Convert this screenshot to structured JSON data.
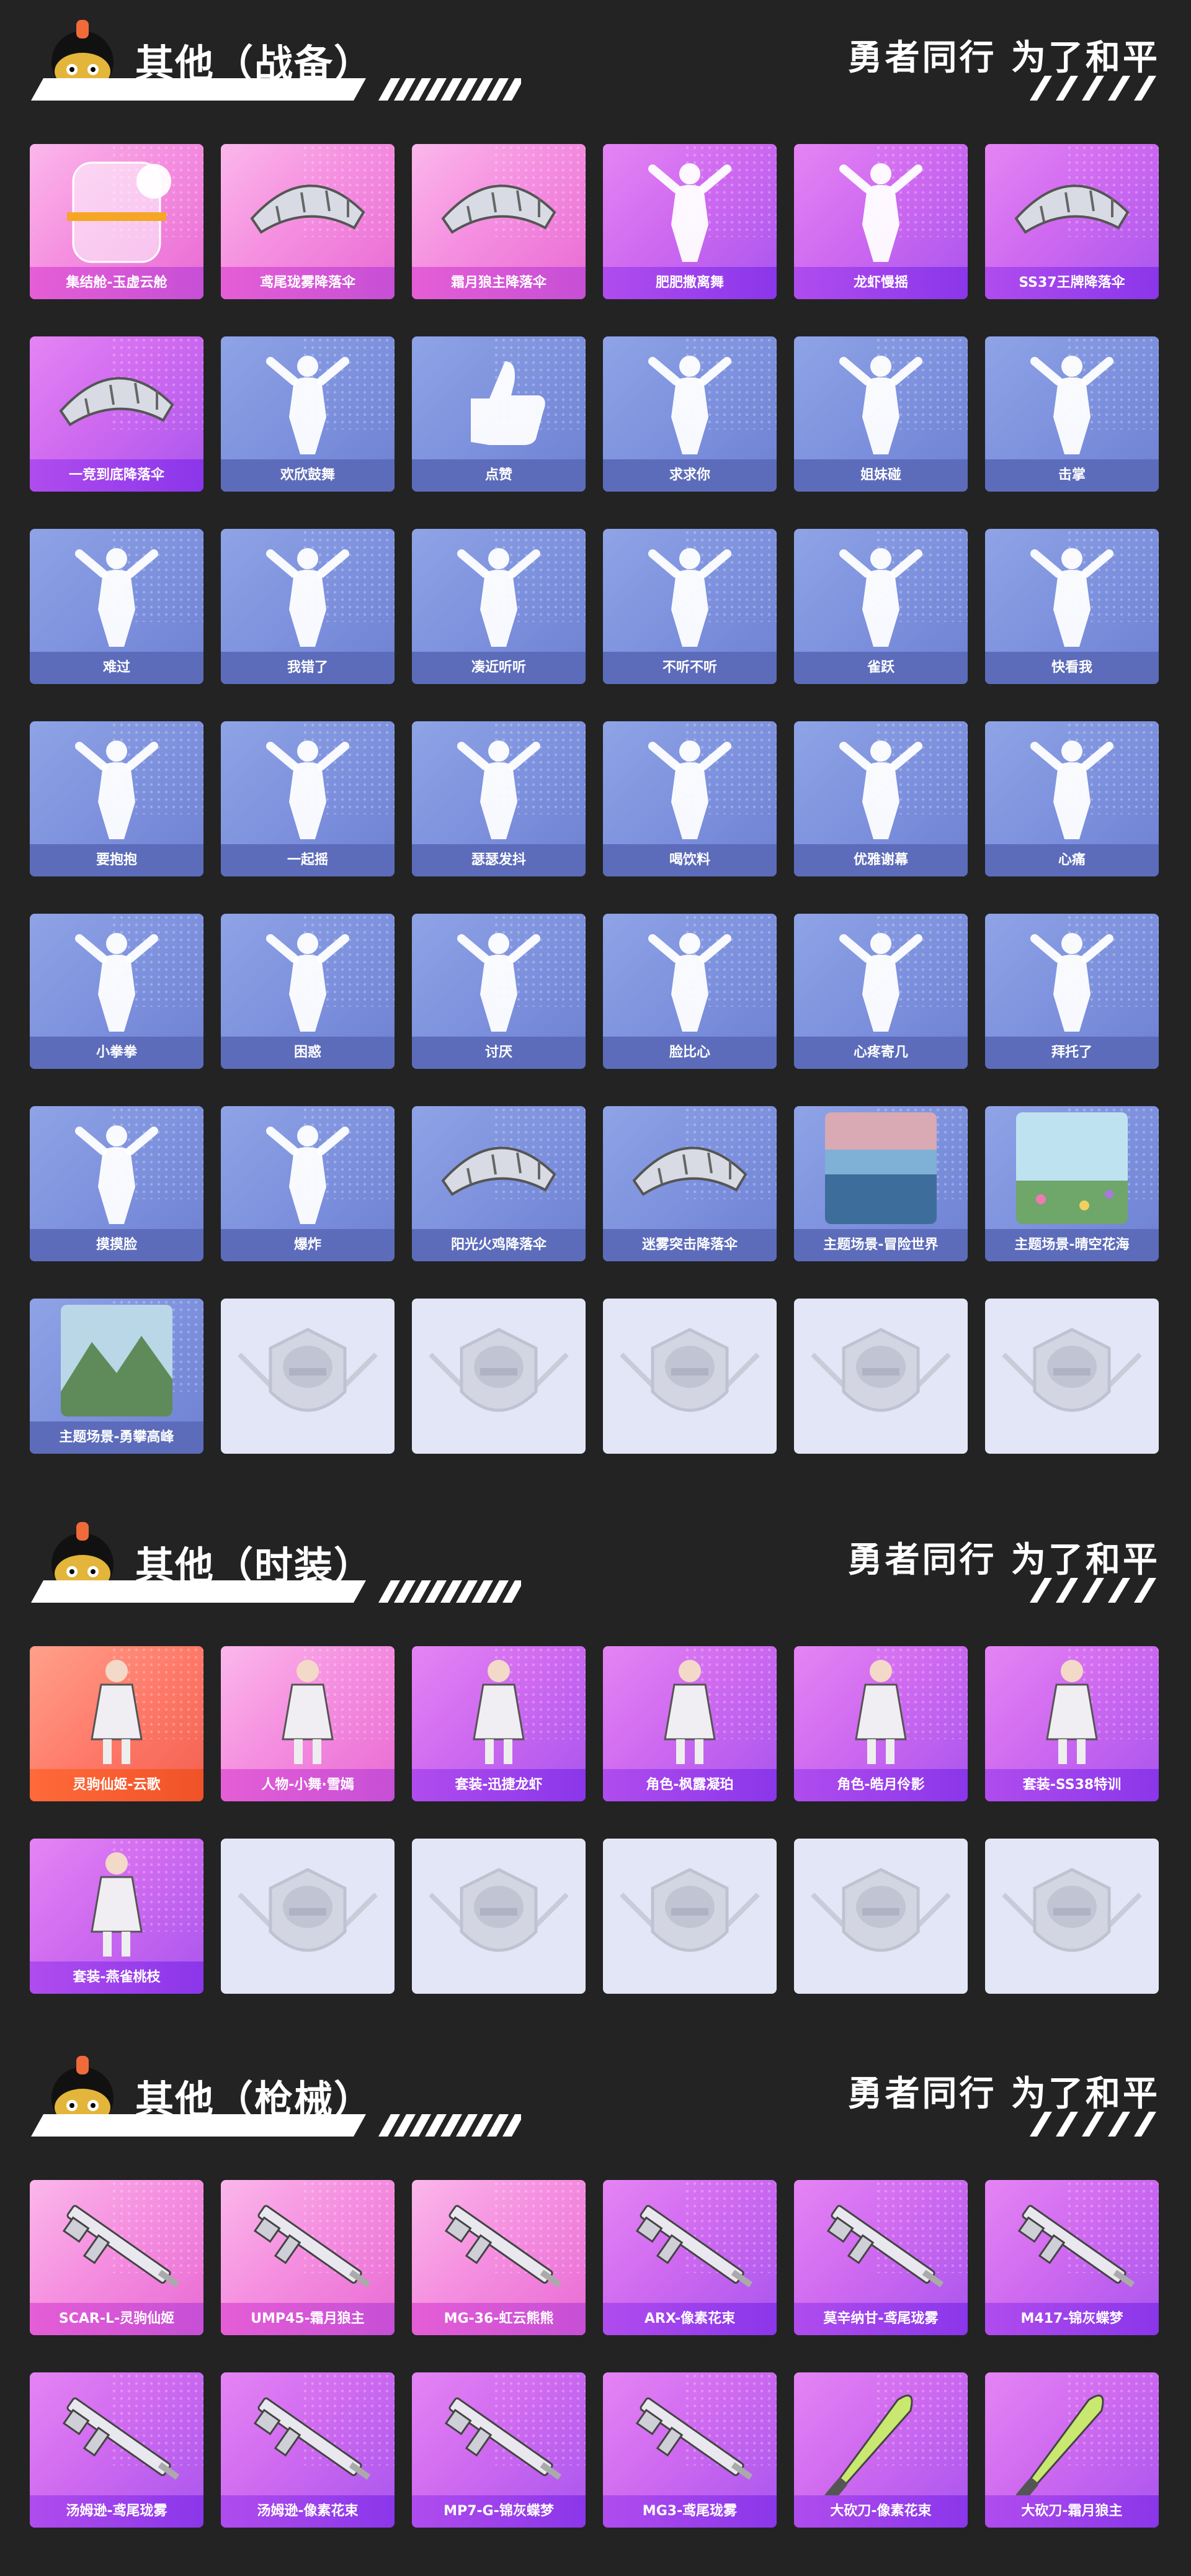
{
  "slogan": "勇者同行 为了和平",
  "sections": [
    {
      "title": "其他（战备）",
      "items": [
        {
          "label": "集结舱-玉虚云舱",
          "theme": "pink",
          "icon": "capsule-icon"
        },
        {
          "label": "鸢尾珑雾降落伞",
          "theme": "pink",
          "icon": "parachute-icon"
        },
        {
          "label": "霜月狼主降落伞",
          "theme": "pink",
          "icon": "parachute-icon"
        },
        {
          "label": "肥肥撒离舞",
          "theme": "purple",
          "icon": "emote-figure-icon"
        },
        {
          "label": "龙虾慢摇",
          "theme": "purple",
          "icon": "emote-figure-icon"
        },
        {
          "label": "SS37王牌降落伞",
          "theme": "purple",
          "icon": "parachute-icon"
        },
        {
          "label": "一竞到底降落伞",
          "theme": "purple",
          "icon": "parachute-icon"
        },
        {
          "label": "欢欣鼓舞",
          "theme": "blue",
          "icon": "emote-figure-icon"
        },
        {
          "label": "点赞",
          "theme": "blue",
          "icon": "thumbs-up-icon"
        },
        {
          "label": "求求你",
          "theme": "blue",
          "icon": "emote-figure-icon"
        },
        {
          "label": "姐妹碰",
          "theme": "blue",
          "icon": "emote-figure-icon"
        },
        {
          "label": "击掌",
          "theme": "blue",
          "icon": "emote-figure-icon"
        },
        {
          "label": "难过",
          "theme": "blue",
          "icon": "emote-figure-icon"
        },
        {
          "label": "我错了",
          "theme": "blue",
          "icon": "emote-figure-icon"
        },
        {
          "label": "凑近听听",
          "theme": "blue",
          "icon": "emote-figure-icon"
        },
        {
          "label": "不听不听",
          "theme": "blue",
          "icon": "emote-figure-icon"
        },
        {
          "label": "雀跃",
          "theme": "blue",
          "icon": "emote-figure-icon"
        },
        {
          "label": "快看我",
          "theme": "blue",
          "icon": "emote-figure-icon"
        },
        {
          "label": "要抱抱",
          "theme": "blue",
          "icon": "emote-figure-icon"
        },
        {
          "label": "一起摇",
          "theme": "blue",
          "icon": "emote-figure-icon"
        },
        {
          "label": "瑟瑟发抖",
          "theme": "blue",
          "icon": "emote-figure-icon"
        },
        {
          "label": "喝饮料",
          "theme": "blue",
          "icon": "emote-figure-icon"
        },
        {
          "label": "优雅谢幕",
          "theme": "blue",
          "icon": "emote-figure-icon"
        },
        {
          "label": "心痛",
          "theme": "blue",
          "icon": "emote-figure-icon"
        },
        {
          "label": "小拳拳",
          "theme": "blue",
          "icon": "emote-figure-icon"
        },
        {
          "label": "困惑",
          "theme": "blue",
          "icon": "emote-figure-icon"
        },
        {
          "label": "讨厌",
          "theme": "blue",
          "icon": "emote-figure-icon"
        },
        {
          "label": "脸比心",
          "theme": "blue",
          "icon": "emote-figure-icon"
        },
        {
          "label": "心疼寄几",
          "theme": "blue",
          "icon": "emote-figure-icon"
        },
        {
          "label": "拜托了",
          "theme": "blue",
          "icon": "emote-figure-icon"
        },
        {
          "label": "摸摸脸",
          "theme": "blue",
          "icon": "emote-figure-icon"
        },
        {
          "label": "爆炸",
          "theme": "blue",
          "icon": "emote-figure-icon"
        },
        {
          "label": "阳光火鸡降落伞",
          "theme": "blue",
          "icon": "parachute-icon"
        },
        {
          "label": "迷雾突击降落伞",
          "theme": "blue",
          "icon": "parachute-icon"
        },
        {
          "label": "主题场景-冒险世界",
          "theme": "blue",
          "icon": "scene-sea-icon"
        },
        {
          "label": "主题场景-晴空花海",
          "theme": "blue",
          "icon": "scene-flowers-icon"
        },
        {
          "label": "主题场景-勇攀高峰",
          "theme": "blue",
          "icon": "scene-mountain-icon"
        },
        {
          "label": "",
          "theme": "empty",
          "icon": "placeholder-emblem-icon"
        },
        {
          "label": "",
          "theme": "empty",
          "icon": "placeholder-emblem-icon"
        },
        {
          "label": "",
          "theme": "empty",
          "icon": "placeholder-emblem-icon"
        },
        {
          "label": "",
          "theme": "empty",
          "icon": "placeholder-emblem-icon"
        },
        {
          "label": "",
          "theme": "empty",
          "icon": "placeholder-emblem-icon"
        }
      ]
    },
    {
      "title": "其他（时装）",
      "items": [
        {
          "label": "灵驹仙姬-云歌",
          "theme": "orange",
          "icon": "outfit-icon"
        },
        {
          "label": "人物-小舞·雪嫣",
          "theme": "pink",
          "icon": "outfit-icon"
        },
        {
          "label": "套装-迅捷龙虾",
          "theme": "purple",
          "icon": "outfit-icon"
        },
        {
          "label": "角色-枫露凝珀",
          "theme": "purple",
          "icon": "outfit-icon"
        },
        {
          "label": "角色-皓月伶影",
          "theme": "purple",
          "icon": "outfit-icon"
        },
        {
          "label": "套装-SS38特训",
          "theme": "purple",
          "icon": "outfit-icon"
        },
        {
          "label": "套装-燕雀桃枝",
          "theme": "purple",
          "icon": "outfit-icon"
        },
        {
          "label": "",
          "theme": "empty",
          "icon": "placeholder-emblem-icon"
        },
        {
          "label": "",
          "theme": "empty",
          "icon": "placeholder-emblem-icon"
        },
        {
          "label": "",
          "theme": "empty",
          "icon": "placeholder-emblem-icon"
        },
        {
          "label": "",
          "theme": "empty",
          "icon": "placeholder-emblem-icon"
        },
        {
          "label": "",
          "theme": "empty",
          "icon": "placeholder-emblem-icon"
        }
      ]
    },
    {
      "title": "其他（枪械）",
      "items": [
        {
          "label": "SCAR-L-灵驹仙姬",
          "theme": "pink",
          "icon": "rifle-icon"
        },
        {
          "label": "UMP45-霜月狼主",
          "theme": "pink",
          "icon": "rifle-icon"
        },
        {
          "label": "MG-36-虹云熊熊",
          "theme": "pink",
          "icon": "rifle-icon"
        },
        {
          "label": "ARX-像素花束",
          "theme": "purple",
          "icon": "rifle-icon"
        },
        {
          "label": "莫辛纳甘-鸢尾珑雾",
          "theme": "purple",
          "icon": "rifle-icon"
        },
        {
          "label": "M417-锦灰蝶梦",
          "theme": "purple",
          "icon": "rifle-icon"
        },
        {
          "label": "汤姆逊-鸢尾珑雾",
          "theme": "purple",
          "icon": "rifle-icon"
        },
        {
          "label": "汤姆逊-像素花束",
          "theme": "purple",
          "icon": "rifle-icon"
        },
        {
          "label": "MP7-G-锦灰蝶梦",
          "theme": "purple",
          "icon": "rifle-icon"
        },
        {
          "label": "MG3-鸢尾珑雾",
          "theme": "purple",
          "icon": "rifle-icon"
        },
        {
          "label": "大砍刀-像素花束",
          "theme": "purple",
          "icon": "machete-icon"
        },
        {
          "label": "大砍刀-霜月狼主",
          "theme": "purple",
          "icon": "machete-icon"
        }
      ]
    }
  ]
}
